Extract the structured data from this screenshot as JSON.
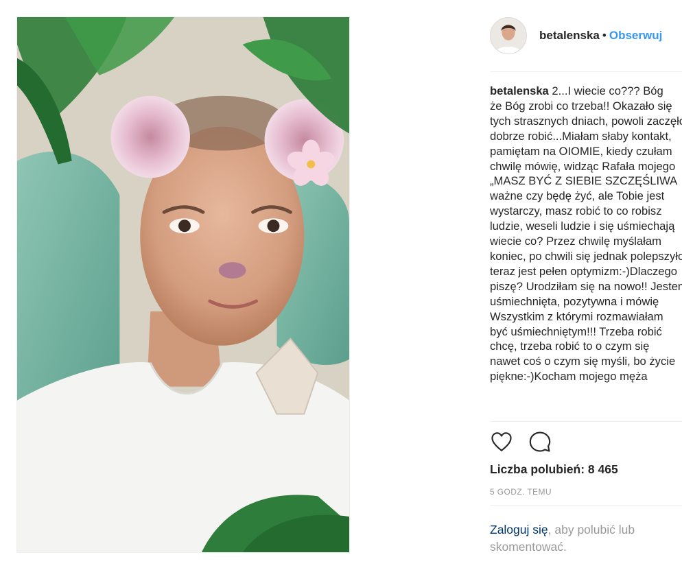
{
  "post": {
    "username": "betalenska",
    "separator": "•",
    "follow_label": "Obserwuj",
    "caption_username": "betalenska",
    "caption_lines": [
      "2...I wiecie co??? Bóg",
      "że Bóg zrobi co trzeba!! Okazało się",
      "tych strasznych dniach, powoli zaczęło",
      "dobrze robić...Miałam słaby kontakt,",
      "pamiętam na OIOMIE, kiedy czułam",
      "chwilę mówię, widząc Rafała mojego",
      "„MASZ BYĆ Z SIEBIE SZCZĘŚLIWA",
      "ważne czy będę żyć, ale Tobie jest",
      "wystarczy, masz robić to co robisz",
      "ludzie, weseli ludzie i się uśmiechają",
      "wiecie co? Przez chwilę myślałam",
      "koniec, po chwili się jednak polepszyło",
      "teraz jest pełen optymizm:-)Dlaczego",
      "piszę? Urodziłam się na nowo!! Jestem",
      "uśmiechnięta, pozytywna i mówię",
      "Wszystkim z którymi rozmawiałam",
      "być uśmiechniętym!!! Trzeba robić",
      "chcę, trzeba robić to o czym się",
      "nawet coś o czym się myśli, bo życie",
      "piękne:-)Kocham mojego męża"
    ],
    "likes": "Liczba polubień: 8 465",
    "time": "5 GODZ. TEMU",
    "login_link": "Zaloguj się",
    "login_rest": ", aby polubić lub skomentować."
  },
  "icons": {
    "like": "heart-icon",
    "comment": "comment-icon"
  },
  "colors": {
    "follow": "#3897f0",
    "text": "#262626",
    "muted": "#999999",
    "link": "#003569",
    "divider": "#efefef"
  }
}
